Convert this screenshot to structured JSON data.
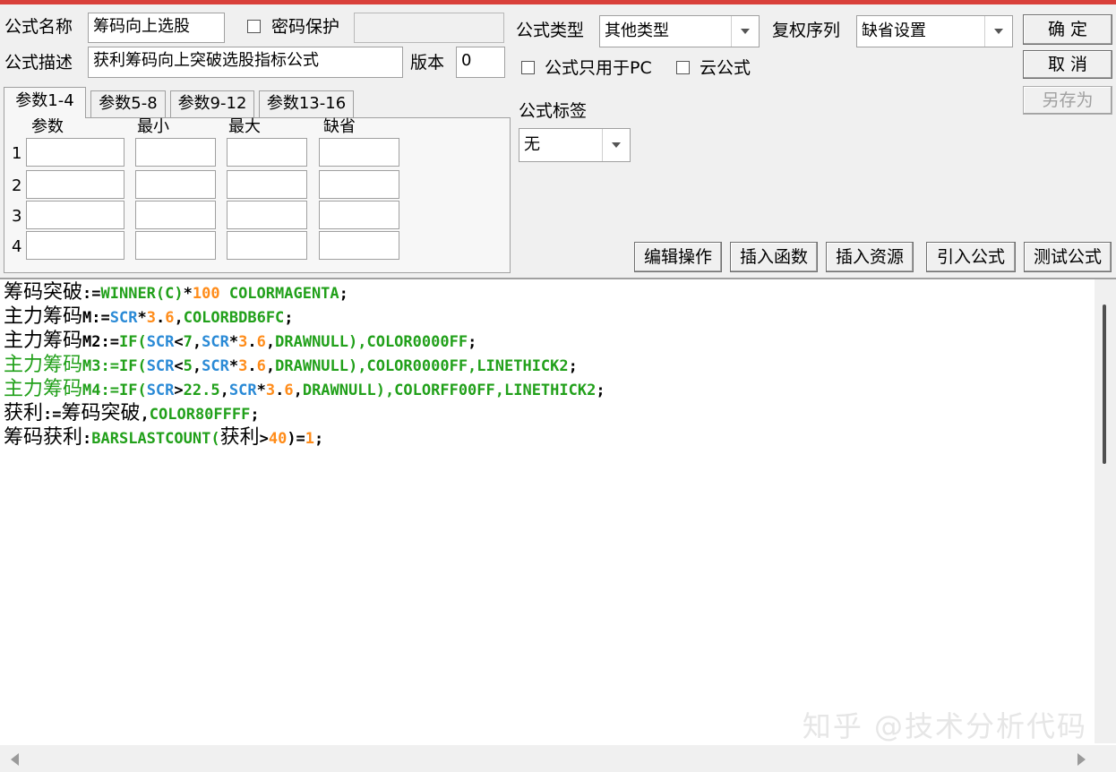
{
  "colors": {
    "editor_default": "#000000",
    "green": "#21a01a",
    "orange": "#ff8c1a",
    "blue": "#2a8ad6",
    "title_bar": "#d9403a"
  },
  "form": {
    "name_label": "公式名称",
    "name_value": "筹码向上选股",
    "password_label": "密码保护",
    "password_value": "",
    "desc_label": "公式描述",
    "desc_value": "获利筹码向上突破选股指标公式",
    "version_label": "版本",
    "version_value": "0",
    "type_label": "公式类型",
    "type_value": "其他类型",
    "restore_label": "复权序列",
    "restore_value": "缺省设置",
    "pc_only_label": "公式只用于PC",
    "cloud_label": "云公式",
    "tag_label": "公式标签",
    "tag_value": "无"
  },
  "buttons": {
    "ok": "确 定",
    "cancel": "取 消",
    "save_as": "另存为",
    "edit_ops": "编辑操作",
    "insert_func": "插入函数",
    "insert_res": "插入资源",
    "import_formula": "引入公式",
    "test_formula": "测试公式"
  },
  "tabs": [
    "参数1-4",
    "参数5-8",
    "参数9-12",
    "参数13-16"
  ],
  "params": {
    "headers": [
      "参数",
      "最小",
      "最大",
      "缺省"
    ],
    "rows": [
      "1",
      "2",
      "3",
      "4"
    ]
  },
  "code": [
    [
      {
        "t": "筹码突破",
        "c": "zh"
      },
      {
        "t": ":=",
        "c": "k"
      },
      {
        "t": "WINNER(C)",
        "c": "g"
      },
      {
        "t": "*",
        "c": "k"
      },
      {
        "t": "100",
        "c": "o"
      },
      {
        "t": " COLORMAGENTA",
        "c": "g"
      },
      {
        "t": ";",
        "c": "k"
      }
    ],
    [
      {
        "t": "主力筹码",
        "c": "zh"
      },
      {
        "t": "M:=",
        "c": "k"
      },
      {
        "t": "SCR",
        "c": "b"
      },
      {
        "t": "*",
        "c": "k"
      },
      {
        "t": "3",
        "c": "o"
      },
      {
        "t": ".",
        "c": "k"
      },
      {
        "t": "6",
        "c": "o"
      },
      {
        "t": ",",
        "c": "k"
      },
      {
        "t": "COLORBDB6FC",
        "c": "g"
      },
      {
        "t": ";",
        "c": "k"
      }
    ],
    [
      {
        "t": "主力筹码",
        "c": "zh"
      },
      {
        "t": "M2:=",
        "c": "k"
      },
      {
        "t": "IF(",
        "c": "g"
      },
      {
        "t": "SCR",
        "c": "b"
      },
      {
        "t": "<",
        "c": "k"
      },
      {
        "t": "7",
        "c": "g"
      },
      {
        "t": ",",
        "c": "k"
      },
      {
        "t": "SCR",
        "c": "b"
      },
      {
        "t": "*",
        "c": "k"
      },
      {
        "t": "3",
        "c": "o"
      },
      {
        "t": ".",
        "c": "k"
      },
      {
        "t": "6",
        "c": "o"
      },
      {
        "t": ",",
        "c": "k"
      },
      {
        "t": "DRAWNULL),COLOR0000FF",
        "c": "g"
      },
      {
        "t": ";",
        "c": "k"
      }
    ],
    [
      {
        "t": "主力筹码",
        "c": "zhg"
      },
      {
        "t": "M3:=",
        "c": "g"
      },
      {
        "t": "IF(",
        "c": "g"
      },
      {
        "t": "SCR",
        "c": "b"
      },
      {
        "t": "<",
        "c": "k"
      },
      {
        "t": "5",
        "c": "g"
      },
      {
        "t": ",",
        "c": "k"
      },
      {
        "t": "SCR",
        "c": "b"
      },
      {
        "t": "*",
        "c": "k"
      },
      {
        "t": "3",
        "c": "o"
      },
      {
        "t": ".",
        "c": "k"
      },
      {
        "t": "6",
        "c": "o"
      },
      {
        "t": ",",
        "c": "k"
      },
      {
        "t": "DRAWNULL),COLOR0000FF,LINETHICK2",
        "c": "g"
      },
      {
        "t": ";",
        "c": "k"
      }
    ],
    [
      {
        "t": "主力筹码",
        "c": "zhg"
      },
      {
        "t": "M4:=",
        "c": "g"
      },
      {
        "t": "IF(",
        "c": "g"
      },
      {
        "t": "SCR",
        "c": "b"
      },
      {
        "t": ">",
        "c": "k"
      },
      {
        "t": "22.5",
        "c": "g"
      },
      {
        "t": ",",
        "c": "k"
      },
      {
        "t": "SCR",
        "c": "b"
      },
      {
        "t": "*",
        "c": "k"
      },
      {
        "t": "3",
        "c": "o"
      },
      {
        "t": ".",
        "c": "k"
      },
      {
        "t": "6",
        "c": "o"
      },
      {
        "t": ",",
        "c": "k"
      },
      {
        "t": "DRAWNULL),COLORFF00FF,LINETHICK2",
        "c": "g"
      },
      {
        "t": ";",
        "c": "k"
      }
    ],
    [
      {
        "t": "获利",
        "c": "zh"
      },
      {
        "t": ":=",
        "c": "k"
      },
      {
        "t": "筹码突破",
        "c": "zh"
      },
      {
        "t": ",",
        "c": "k"
      },
      {
        "t": "COLOR80FFFF",
        "c": "g"
      },
      {
        "t": ";",
        "c": "k"
      }
    ],
    [
      {
        "t": "筹码获利",
        "c": "zh"
      },
      {
        "t": ":",
        "c": "k"
      },
      {
        "t": "BARSLASTCOUNT(",
        "c": "g"
      },
      {
        "t": "获利",
        "c": "zh"
      },
      {
        "t": ">",
        "c": "k"
      },
      {
        "t": "40",
        "c": "o"
      },
      {
        "t": ")=",
        "c": "k"
      },
      {
        "t": "1",
        "c": "o"
      },
      {
        "t": ";",
        "c": "k"
      }
    ]
  ],
  "watermark": "知乎 @技术分析代码"
}
